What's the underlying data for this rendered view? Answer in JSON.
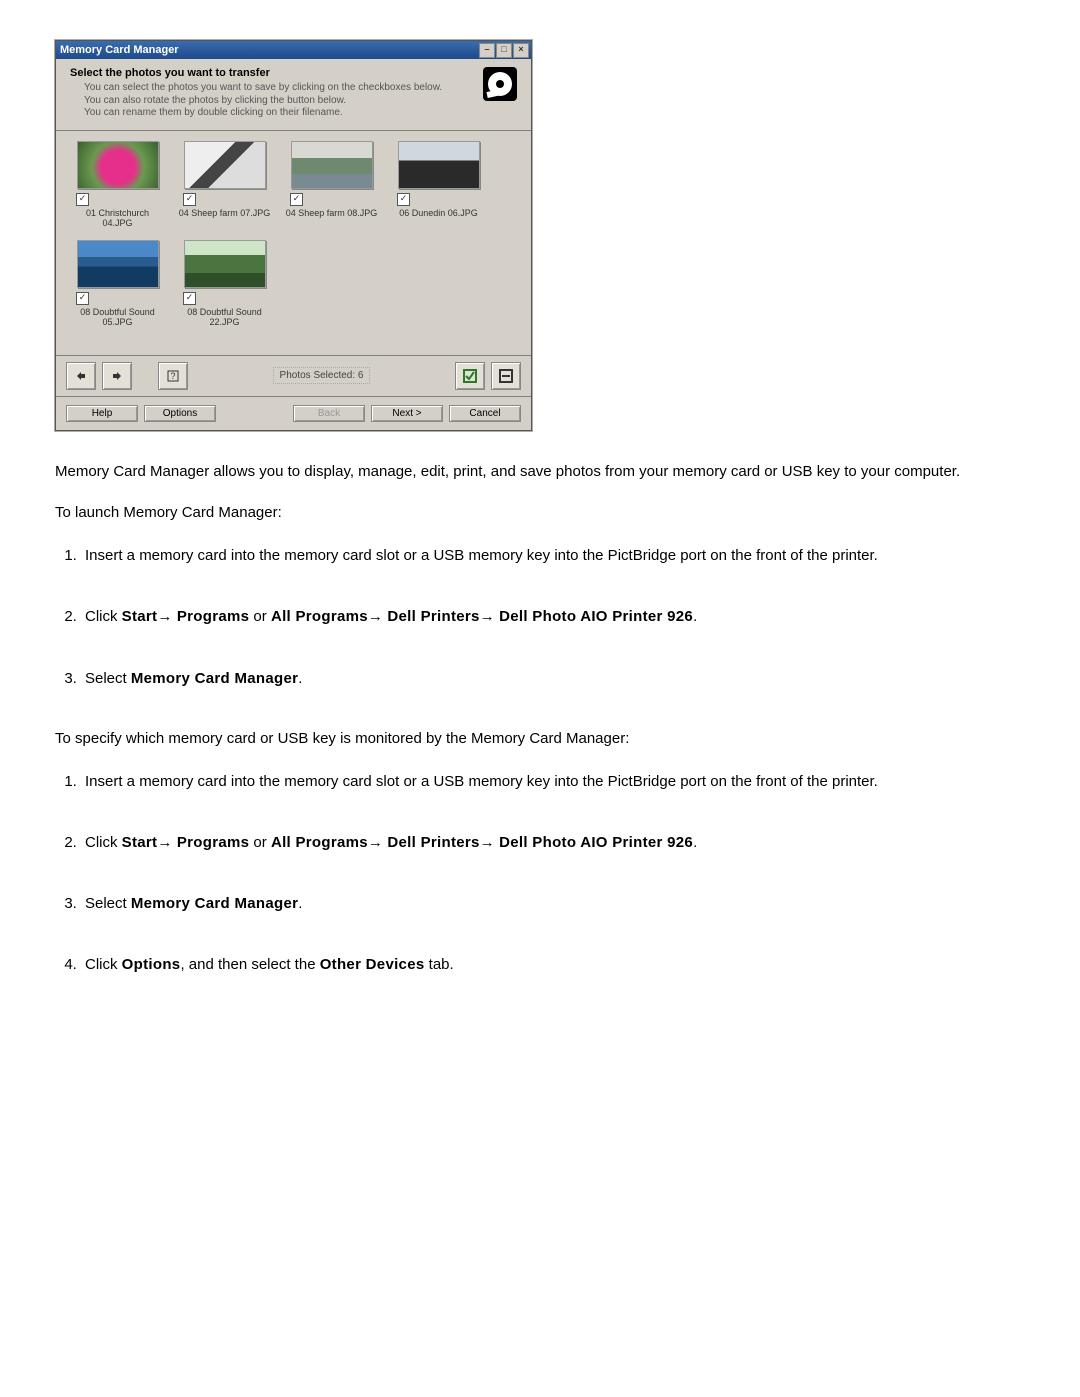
{
  "window": {
    "title": "Memory Card Manager",
    "instruct_title": "Select the photos you want to transfer",
    "instruct_lines": [
      "You can select the photos you want to save by clicking on the checkboxes below.",
      "You can also rotate the photos by clicking the button below.",
      "You can rename them by double clicking on their filename."
    ],
    "thumbs": [
      {
        "label": "01 Christchurch 04.JPG",
        "cls": "ph-flower"
      },
      {
        "label": "04 Sheep farm 07.JPG",
        "cls": "ph-bw"
      },
      {
        "label": "04 Sheep farm 08.JPG",
        "cls": "ph-coast"
      },
      {
        "label": "06 Dunedin 06.JPG",
        "cls": "ph-sky"
      },
      {
        "label": "08 Doubtful Sound 05.JPG",
        "cls": "ph-mtn"
      },
      {
        "label": "08 Doubtful Sound 22.JPG",
        "cls": "ph-field"
      }
    ],
    "photos_selected_label": "Photos Selected: 6",
    "buttons": {
      "help": "Help",
      "options": "Options",
      "back": "Back",
      "next": "Next >",
      "cancel": "Cancel"
    }
  },
  "doc": {
    "intro_para": "Memory Card Manager allows you to display, manage, edit, print, and save photos from your memory card or USB key to your computer.",
    "launch_lead": "To launch Memory Card Manager:",
    "launch_steps": {
      "s1": "Insert a memory card into the memory card slot or a USB memory key into the PictBridge port on the front of the printer.",
      "s2_prefix": "Click ",
      "s2_start": "Start",
      "s2_seg2": " Programs",
      "s2_seg2b": " or ",
      "s2_seg2c": "All Programs",
      "s2_seg3": " Dell Printers",
      "s2_seg4": " Dell Photo AIO Printer 926",
      "s3_prefix": "Select ",
      "s3_target": "Memory Card Manager"
    },
    "specify_lead": "To specify which memory card or USB key is monitored by the Memory Card Manager:",
    "specify_steps": {
      "s4_prefix": "Click ",
      "s4_opt": "Options",
      "s4_mid": ", and then select the ",
      "s4_tab": "Other Devices",
      "s4_suffix": " tab."
    },
    "arrow": "→",
    "period": "."
  }
}
